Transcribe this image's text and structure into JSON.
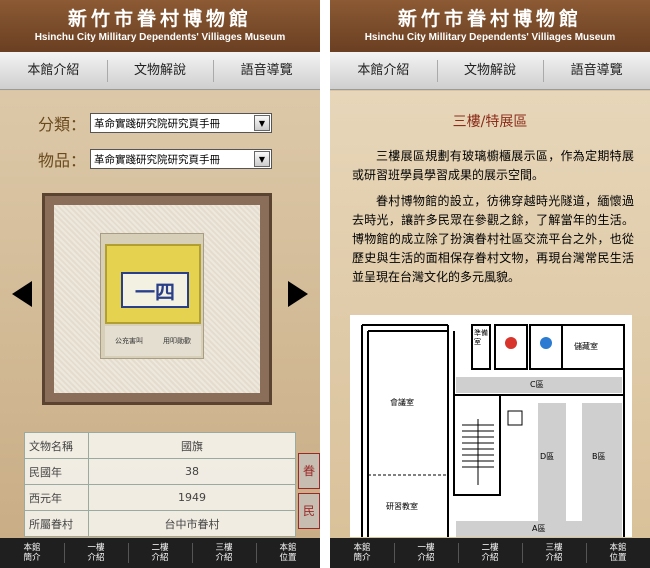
{
  "app": {
    "title": "新竹市眷村博物館",
    "subtitle": "Hsinchu City Millitary Dependents' Villiages Museum"
  },
  "top_tabs": [
    "本館介紹",
    "文物解說",
    "語音導覽"
  ],
  "bottom_nav": [
    {
      "line1": "本館",
      "line2": "簡介"
    },
    {
      "line1": "一樓",
      "line2": "介紹"
    },
    {
      "line1": "二樓",
      "line2": "介紹"
    },
    {
      "line1": "三樓",
      "line2": "介紹"
    },
    {
      "line1": "本館",
      "line2": "位置"
    }
  ],
  "artifact_screen": {
    "category_label": "分類：",
    "category_value": "革命實踐研究院研究頁手冊",
    "item_label": "物品：",
    "item_value": "革命實踐研究院研究頁手冊",
    "artifact_text": {
      "big": "一四",
      "lower_left": "公充害叫",
      "lower_right": "用叩勛歡"
    },
    "table": [
      {
        "key": "文物名稱",
        "value": "國旗"
      },
      {
        "key": "民國年",
        "value": "38"
      },
      {
        "key": "西元年",
        "value": "1949"
      },
      {
        "key": "所屬眷村",
        "value": "台中市眷村"
      }
    ],
    "seals": [
      "眷",
      "民"
    ]
  },
  "floor_screen": {
    "section_title": "三樓/特展區",
    "paragraph1": "三樓展區規劃有玻璃櫥櫃展示區，作為定期特展或研習班學員學習成果的展示空間。",
    "paragraph2": "眷村博物館的設立，彷彿穿越時光隧道，緬懷過去時光，讓許多民眾在參觀之餘，了解當年的生活。博物館的成立除了扮演眷村社區交流平台之外，也從歷史與生活的面相保存眷村文物，再現台灣常民生活並呈現在台灣文化的多元風貌。",
    "plan_labels": {
      "meeting_room": "會議室",
      "study_room": "研習教室",
      "prep_room": "準備室",
      "storage_room": "儲藏室",
      "zone_a": "A區",
      "zone_b": "B區",
      "zone_c": "C區",
      "zone_d": "D區"
    }
  }
}
